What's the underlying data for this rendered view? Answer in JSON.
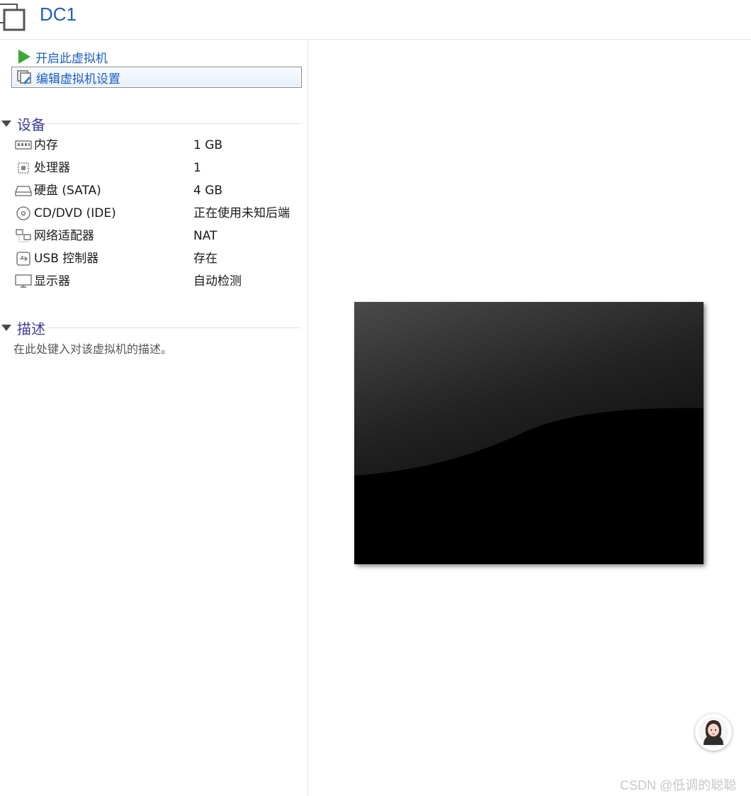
{
  "header": {
    "title": "DC1"
  },
  "actions": {
    "power_on": "开启此虚拟机",
    "edit_settings": "编辑虚拟机设置"
  },
  "devices": {
    "section_title": "设备",
    "items": [
      {
        "name": "内存",
        "value": "1 GB",
        "icon": "memory-icon"
      },
      {
        "name": "处理器",
        "value": "1",
        "icon": "processor-icon"
      },
      {
        "name": "硬盘 (SATA)",
        "value": "4 GB",
        "icon": "hard-disk-icon"
      },
      {
        "name": "CD/DVD (IDE)",
        "value": "正在使用未知后端",
        "icon": "cd-dvd-icon"
      },
      {
        "name": "网络适配器",
        "value": "NAT",
        "icon": "network-adapter-icon"
      },
      {
        "name": "USB 控制器",
        "value": "存在",
        "icon": "usb-icon"
      },
      {
        "name": "显示器",
        "value": "自动检测",
        "icon": "display-icon"
      }
    ]
  },
  "description": {
    "section_title": "描述",
    "placeholder": "在此处键入对该虚拟机的描述。"
  },
  "watermark": "CSDN @低调的聪聪",
  "colors": {
    "title_blue": "#1f5fbf",
    "section_purple": "#3d3d9b",
    "play_green": "#3aa832"
  }
}
